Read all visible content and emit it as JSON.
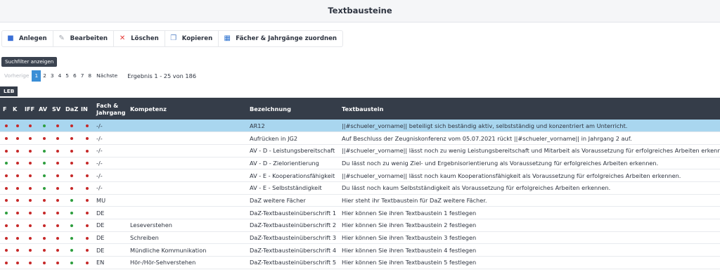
{
  "window": {
    "title": "Textbausteine"
  },
  "toolbar": {
    "buttons": [
      {
        "label": "Anlegen",
        "icon": "add-user-icon"
      },
      {
        "label": "Bearbeiten",
        "icon": "edit-icon"
      },
      {
        "label": "Löschen",
        "icon": "delete-x-icon"
      },
      {
        "label": "Kopieren",
        "icon": "copy-icon"
      },
      {
        "label": "Fächer & Jahrgänge zuordnen",
        "icon": "assign-icon"
      }
    ]
  },
  "filter": {
    "label": "Suchfilter anzeigen"
  },
  "pagination": {
    "prev": "Vorherige",
    "next": "Nächste",
    "pages": [
      "1",
      "2",
      "3",
      "4",
      "5",
      "6",
      "7",
      "8"
    ],
    "current": "1",
    "result": "Ergebnis 1 - 25 von 186"
  },
  "section": {
    "label": "LEB"
  },
  "colors": {
    "flag_red": "#c62828",
    "flag_green": "#2e9e3e",
    "selected_row": "#a9d6ef",
    "header_bg": "#353d49",
    "page_active": "#3a8ed6"
  },
  "table": {
    "headers": {
      "f": "F",
      "k": "K",
      "iff": "IFF",
      "av": "AV",
      "sv": "SV",
      "daz": "DaZ",
      "in": "IN",
      "fach_line1": "Fach &",
      "fach_line2": "Jahrgang",
      "kompetenz": "Kompetenz",
      "bezeichnung": "Bezeichnung",
      "textbaustein": "Textbaustein"
    },
    "rows": [
      {
        "flags": [
          "r",
          "r",
          "r",
          "g",
          "r",
          "r",
          "r"
        ],
        "fach": "-/-",
        "kompetenz": "",
        "bezeichnung": "AR12",
        "text": "||#schueler_vorname|| beteiligt sich beständig aktiv, selbstständig und konzentriert am Unterricht."
      },
      {
        "flags": [
          "r",
          "r",
          "r",
          "r",
          "r",
          "r",
          "r"
        ],
        "fach": "-/-",
        "kompetenz": "",
        "bezeichnung": "Aufrücken in JG2",
        "text": "Auf Beschluss der Zeugniskonferenz vom 05.07.2021 rückt ||#schueler_vorname|| in Jahrgang 2 auf."
      },
      {
        "flags": [
          "r",
          "r",
          "r",
          "g",
          "r",
          "r",
          "r"
        ],
        "fach": "-/-",
        "kompetenz": "",
        "bezeichnung": "AV - D - Leistungsbereitschaft",
        "text": "||#schueler_vorname|| lässt noch zu wenig Leistungsbereitschaft und Mitarbeit als Voraussetzung für erfolgreiches Arbeiten erkennen."
      },
      {
        "flags": [
          "g",
          "r",
          "r",
          "g",
          "r",
          "r",
          "r"
        ],
        "fach": "-/-",
        "kompetenz": "",
        "bezeichnung": "AV - D - Zielorientierung",
        "text": "Du lässt noch zu wenig Ziel- und Ergebnisorientierung als Voraussetzung für erfolgreiches Arbeiten erkennen."
      },
      {
        "flags": [
          "r",
          "r",
          "r",
          "g",
          "r",
          "r",
          "r"
        ],
        "fach": "-/-",
        "kompetenz": "",
        "bezeichnung": "AV - E - Kooperationsfähigkeit",
        "text": "||#schueler_vorname|| lässt noch kaum Kooperationsfähigkeit als Voraussetzung für erfolgreiches Arbeiten erkennen."
      },
      {
        "flags": [
          "r",
          "r",
          "r",
          "g",
          "r",
          "r",
          "r"
        ],
        "fach": "-/-",
        "kompetenz": "",
        "bezeichnung": "AV - E - Selbstständigkeit",
        "text": "Du lässt noch kaum Selbstständigkeit als Voraussetzung für erfolgreiches Arbeiten erkennen."
      },
      {
        "flags": [
          "r",
          "r",
          "r",
          "r",
          "r",
          "g",
          "r"
        ],
        "fach": "MU",
        "kompetenz": "",
        "bezeichnung": "DaZ weitere Fächer",
        "text": "Hier steht ihr Textbaustein für DaZ weitere Fächer."
      },
      {
        "flags": [
          "g",
          "r",
          "r",
          "r",
          "r",
          "g",
          "r"
        ],
        "fach": "DE",
        "kompetenz": "",
        "bezeichnung": "DaZ-Textbausteinüberschrift 1",
        "text": "Hier können Sie ihren Textbaustein 1 festlegen"
      },
      {
        "flags": [
          "r",
          "r",
          "r",
          "r",
          "r",
          "g",
          "r"
        ],
        "fach": "DE",
        "kompetenz": "Leseverstehen",
        "bezeichnung": "DaZ-Textbausteinüberschrift 2",
        "text": "Hier können Sie ihren Textbaustein 2 festlegen"
      },
      {
        "flags": [
          "r",
          "r",
          "r",
          "r",
          "r",
          "g",
          "r"
        ],
        "fach": "DE",
        "kompetenz": "Schreiben",
        "bezeichnung": "DaZ-Textbausteinüberschrift 3",
        "text": "Hier können Sie ihren Textbaustein 3 festlegen"
      },
      {
        "flags": [
          "r",
          "r",
          "r",
          "r",
          "r",
          "g",
          "r"
        ],
        "fach": "DE",
        "kompetenz": "Mündliche Kommunikation",
        "bezeichnung": "DaZ-Textbausteinüberschrift 4",
        "text": "Hier können Sie ihren Textbaustein 4 festlegen"
      },
      {
        "flags": [
          "r",
          "r",
          "r",
          "r",
          "r",
          "g",
          "r"
        ],
        "fach": "EN",
        "kompetenz": "Hör-/Hör-Sehverstehen",
        "bezeichnung": "DaZ-Textbausteinüberschrift 5",
        "text": "Hier können Sie ihren Textbaustein 5 festlegen"
      }
    ]
  }
}
